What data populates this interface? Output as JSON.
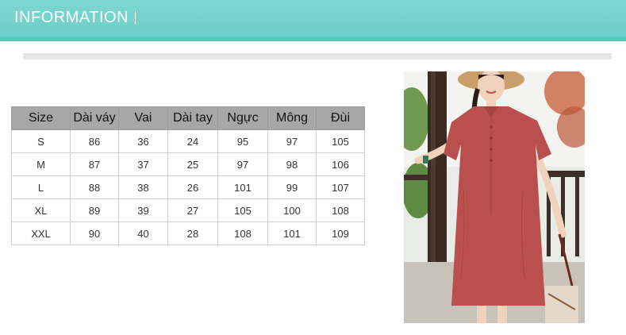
{
  "header": {
    "title": "INFORMATION"
  },
  "size_table": {
    "columns": [
      "Size",
      "Dài váy",
      "Vai",
      "Dài tay",
      "Ngực",
      "Mông",
      "Đùi"
    ],
    "rows": [
      [
        "S",
        "86",
        "36",
        "24",
        "95",
        "97",
        "105"
      ],
      [
        "M",
        "87",
        "37",
        "25",
        "97",
        "98",
        "106"
      ],
      [
        "L",
        "88",
        "38",
        "26",
        "101",
        "99",
        "107"
      ],
      [
        "XL",
        "89",
        "39",
        "27",
        "105",
        "100",
        "108"
      ],
      [
        "XXL",
        "90",
        "40",
        "28",
        "108",
        "101",
        "109"
      ]
    ]
  },
  "colors": {
    "header_bg": "#6ccdc8",
    "table_header_bg": "#a7a7a7",
    "dress": "#b9504d"
  }
}
